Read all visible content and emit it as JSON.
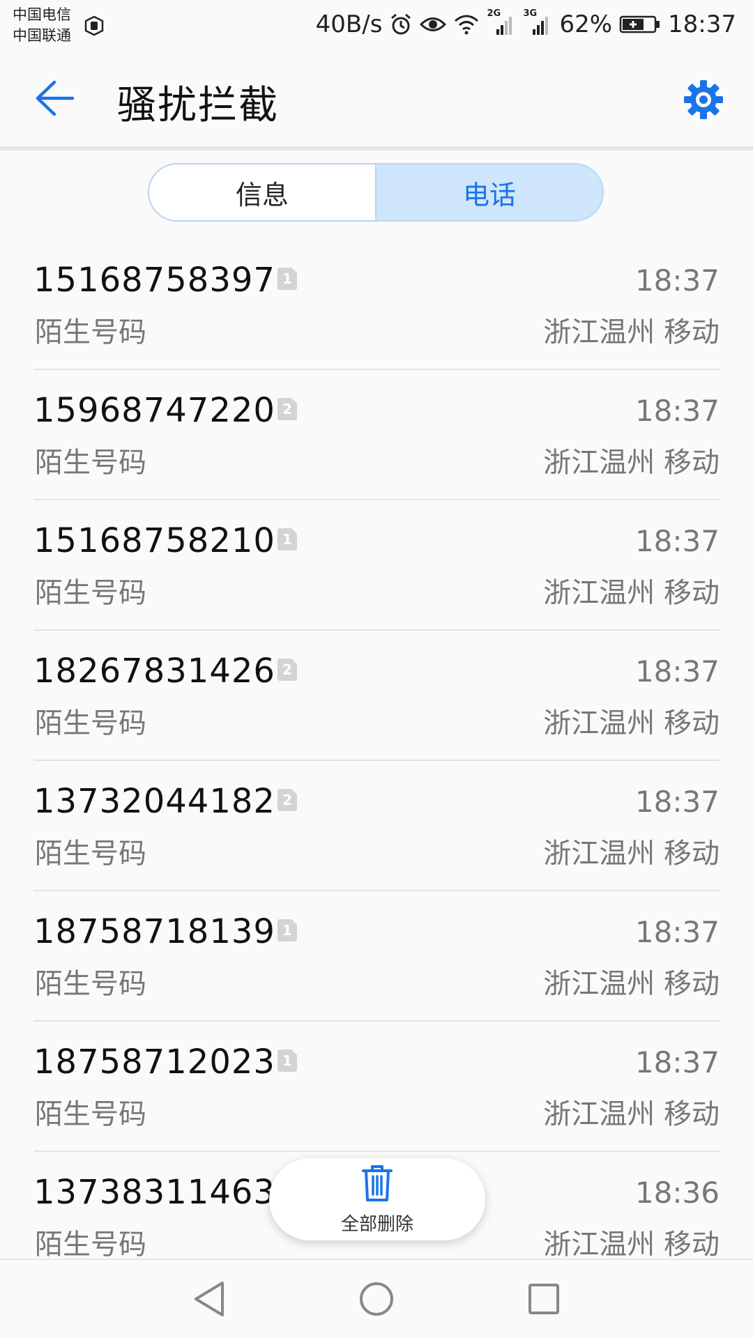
{
  "status_bar": {
    "carrier_1": "中国电信",
    "carrier_2": "中国联通",
    "net_speed": "40B/s",
    "sim1_network": "2G",
    "sim2_network": "3G",
    "battery": "62%",
    "time": "18:37",
    "icons": [
      "carrier-hd-icon",
      "alarm-icon",
      "eye-icon",
      "wifi-icon",
      "signal-icon",
      "battery-icon"
    ]
  },
  "app_bar": {
    "title": "骚扰拦截",
    "back_icon": "back-arrow-icon",
    "settings_icon": "gear-icon"
  },
  "tabs": [
    {
      "label": "信息",
      "active": false
    },
    {
      "label": "电话",
      "active": true
    }
  ],
  "calls": [
    {
      "number": "15168758397",
      "sim": "1",
      "label": "陌生号码",
      "time": "18:37",
      "location": "浙江温州 移动"
    },
    {
      "number": "15968747220",
      "sim": "2",
      "label": "陌生号码",
      "time": "18:37",
      "location": "浙江温州 移动"
    },
    {
      "number": "15168758210",
      "sim": "1",
      "label": "陌生号码",
      "time": "18:37",
      "location": "浙江温州 移动"
    },
    {
      "number": "18267831426",
      "sim": "2",
      "label": "陌生号码",
      "time": "18:37",
      "location": "浙江温州 移动"
    },
    {
      "number": "13732044182",
      "sim": "2",
      "label": "陌生号码",
      "time": "18:37",
      "location": "浙江温州 移动"
    },
    {
      "number": "18758718139",
      "sim": "1",
      "label": "陌生号码",
      "time": "18:37",
      "location": "浙江温州 移动"
    },
    {
      "number": "18758712023",
      "sim": "1",
      "label": "陌生号码",
      "time": "18:37",
      "location": "浙江温州 移动"
    },
    {
      "number": "13738311463",
      "sim": "",
      "label": "陌生号码",
      "time": "18:36",
      "location": "浙江温州 移动"
    }
  ],
  "delete_all": {
    "label": "全部删除",
    "icon": "trash-icon"
  },
  "nav_bar": {
    "icons": [
      "back-triangle-icon",
      "home-circle-icon",
      "recents-square-icon"
    ]
  },
  "colors": {
    "accent": "#1a73e8",
    "tab_active_bg": "#cfe5fb",
    "tab_border": "#b8d5f4"
  }
}
